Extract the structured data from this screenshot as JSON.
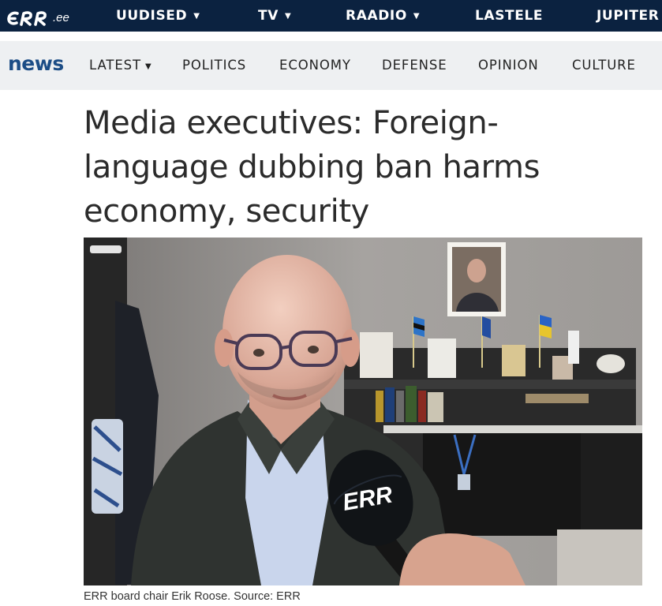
{
  "top_nav": {
    "logo_suffix": ".ee",
    "items": [
      {
        "label": "UUDISED",
        "has_dropdown": true
      },
      {
        "label": "TV",
        "has_dropdown": true
      },
      {
        "label": "RAADIO",
        "has_dropdown": true
      },
      {
        "label": "LASTELE",
        "external": true
      },
      {
        "label": "JUPITER"
      }
    ]
  },
  "news_nav": {
    "brand": "news",
    "items": [
      {
        "label": "LATEST",
        "has_dropdown": true
      },
      {
        "label": "POLITICS"
      },
      {
        "label": "ECONOMY"
      },
      {
        "label": "DEFENSE"
      },
      {
        "label": "OPINION"
      },
      {
        "label": "CULTURE"
      }
    ]
  },
  "article": {
    "headline_lines": [
      "Media executives: Foreign-",
      "language dubbing ban harms",
      "economy, security"
    ],
    "caption": "ERR board chair Erik Roose. Source: ERR",
    "mic_logo": "ERR"
  },
  "colors": {
    "top_bar": "#0b2240",
    "news_bar": "#eef0f2",
    "news_brand": "#1c4d86",
    "headline": "#2b2b2b"
  },
  "icons": [
    "caret-down-icon",
    "external-link-icon",
    "err-logo"
  ]
}
